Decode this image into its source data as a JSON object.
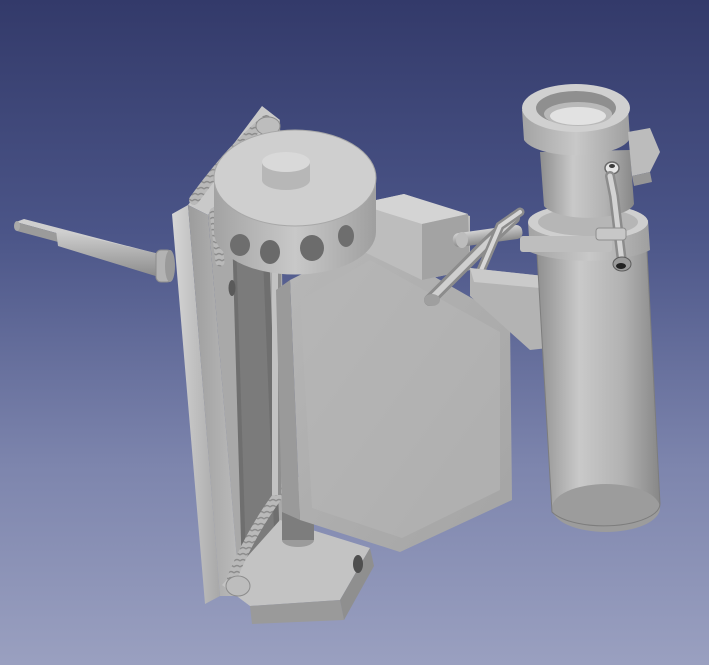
{
  "viewport": {
    "background_top": "#333a6a",
    "background_bottom": "#9aa0c0",
    "model_color": "#b4b4b4"
  }
}
